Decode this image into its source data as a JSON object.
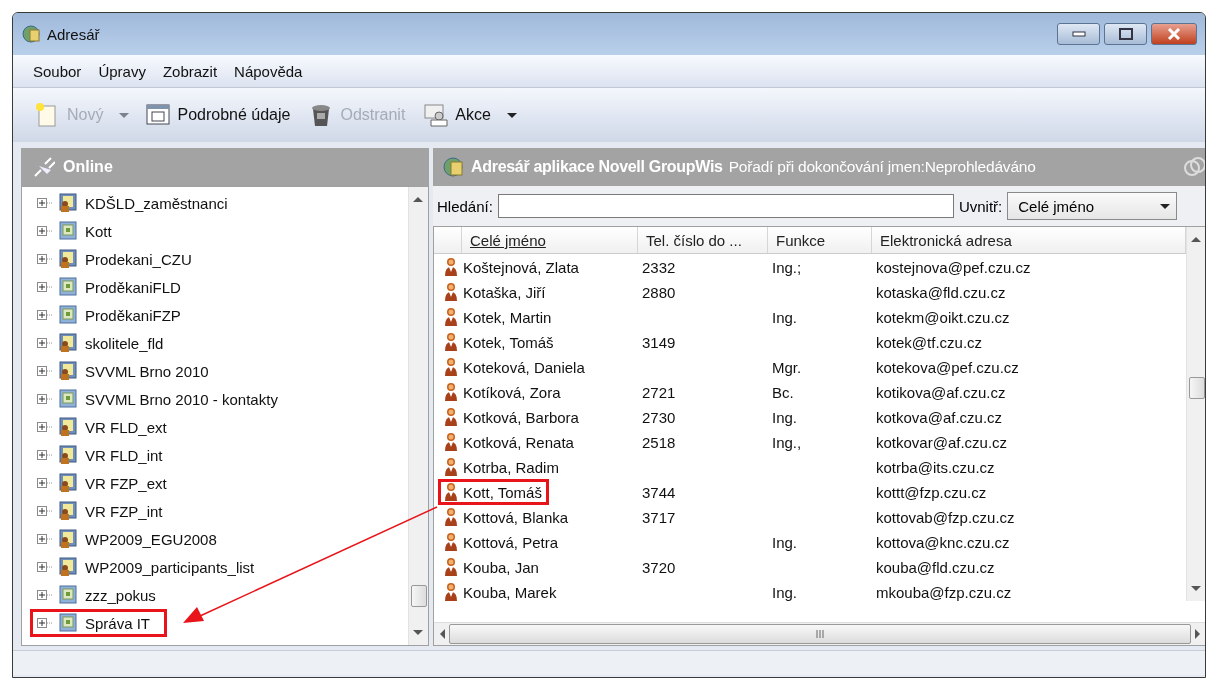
{
  "window": {
    "title": "Adresář"
  },
  "menu": [
    {
      "label": "Soubor"
    },
    {
      "label": "Úpravy"
    },
    {
      "label": "Zobrazit"
    },
    {
      "label": "Nápověda"
    }
  ],
  "toolbar": [
    {
      "kind": "new",
      "label": "Nový",
      "disabled": true,
      "dropdown": true
    },
    {
      "kind": "details",
      "label": "Podrobné údaje",
      "disabled": false,
      "dropdown": false
    },
    {
      "kind": "delete",
      "label": "Odstranit",
      "disabled": true,
      "dropdown": false
    },
    {
      "kind": "actions",
      "label": "Akce",
      "disabled": false,
      "dropdown": true
    }
  ],
  "left_pane": {
    "title": "Online",
    "tree": [
      {
        "label": "KDŠLD_zaměstnanci",
        "kind": "group",
        "expanded": false,
        "highlighted": false
      },
      {
        "label": "Kott",
        "kind": "book",
        "expanded": false,
        "highlighted": false
      },
      {
        "label": "Prodekani_CZU",
        "kind": "group",
        "expanded": false,
        "highlighted": false
      },
      {
        "label": "ProděkaniFLD",
        "kind": "book",
        "expanded": false,
        "highlighted": false
      },
      {
        "label": "ProděkaniFZP",
        "kind": "book",
        "expanded": false,
        "highlighted": false
      },
      {
        "label": "skolitele_fld",
        "kind": "group",
        "expanded": false,
        "highlighted": false
      },
      {
        "label": "SVVML Brno 2010",
        "kind": "group",
        "expanded": false,
        "highlighted": false
      },
      {
        "label": "SVVML Brno 2010 - kontakty",
        "kind": "book",
        "expanded": false,
        "highlighted": false
      },
      {
        "label": "VR FLD_ext",
        "kind": "group",
        "expanded": false,
        "highlighted": false
      },
      {
        "label": "VR FLD_int",
        "kind": "group",
        "expanded": false,
        "highlighted": false
      },
      {
        "label": "VR FZP_ext",
        "kind": "group",
        "expanded": false,
        "highlighted": false
      },
      {
        "label": "VR FZP_int",
        "kind": "group",
        "expanded": false,
        "highlighted": false
      },
      {
        "label": "WP2009_EGU2008",
        "kind": "group",
        "expanded": false,
        "highlighted": false
      },
      {
        "label": "WP2009_participants_list",
        "kind": "group",
        "expanded": false,
        "highlighted": false
      },
      {
        "label": "zzz_pokus",
        "kind": "book",
        "expanded": false,
        "highlighted": false
      },
      {
        "label": "Správa IT",
        "kind": "book",
        "expanded": false,
        "highlighted": true
      }
    ]
  },
  "right_pane": {
    "title": "Adresář aplikace Novell GroupWis",
    "status": "Pořadí při dokončování jmen:Neprohledáváno",
    "search": {
      "label": "Hledání:"
    },
    "scope": {
      "label": "Uvnitř:",
      "value": "Celé jméno"
    },
    "columns": [
      {
        "label": "Celé jméno",
        "sorted": true
      },
      {
        "label": "Tel. číslo do ...",
        "sorted": false
      },
      {
        "label": "Funkce",
        "sorted": false
      },
      {
        "label": "Elektronická adresa",
        "sorted": false
      }
    ],
    "rows": [
      {
        "name": "Koštejnová, Zlata",
        "phone": "2332",
        "function": "Ing.;",
        "email": "kostejnova@pef.czu.cz",
        "highlighted": false
      },
      {
        "name": "Kotaška, Jiří",
        "phone": "2880",
        "email": "kotaska@fld.czu.cz",
        "highlighted": false
      },
      {
        "name": "Kotek, Martin",
        "function": "Ing.",
        "email": "kotekm@oikt.czu.cz",
        "highlighted": false
      },
      {
        "name": "Kotek, Tomáš",
        "phone": "3149",
        "email": "kotek@tf.czu.cz",
        "highlighted": false
      },
      {
        "name": "Koteková, Daniela",
        "function": "Mgr.",
        "email": "kotekova@pef.czu.cz",
        "highlighted": false
      },
      {
        "name": "Kotíková, Zora",
        "phone": "2721",
        "function": "Bc.",
        "email": "kotikova@af.czu.cz",
        "highlighted": false
      },
      {
        "name": "Kotková, Barbora",
        "phone": "2730",
        "function": "Ing.",
        "email": "kotkova@af.czu.cz",
        "highlighted": false
      },
      {
        "name": "Kotková, Renata",
        "phone": "2518",
        "function": "Ing.,",
        "email": "kotkovar@af.czu.cz",
        "highlighted": false
      },
      {
        "name": "Kotrba, Radim",
        "email": "kotrba@its.czu.cz",
        "highlighted": false
      },
      {
        "name": "Kott, Tomáš",
        "phone": "3744",
        "email": "kottt@fzp.czu.cz",
        "highlighted": true
      },
      {
        "name": "Kottová, Blanka",
        "phone": "3717",
        "email": "kottovab@fzp.czu.cz",
        "highlighted": false
      },
      {
        "name": "Kottová, Petra",
        "function": "Ing.",
        "email": "kottova@knc.czu.cz",
        "highlighted": false
      },
      {
        "name": "Kouba, Jan",
        "phone": "3720",
        "email": "kouba@fld.czu.cz",
        "highlighted": false
      },
      {
        "name": "Kouba, Marek",
        "function": "Ing.",
        "email": "mkouba@fzp.czu.cz",
        "highlighted": false
      }
    ]
  }
}
